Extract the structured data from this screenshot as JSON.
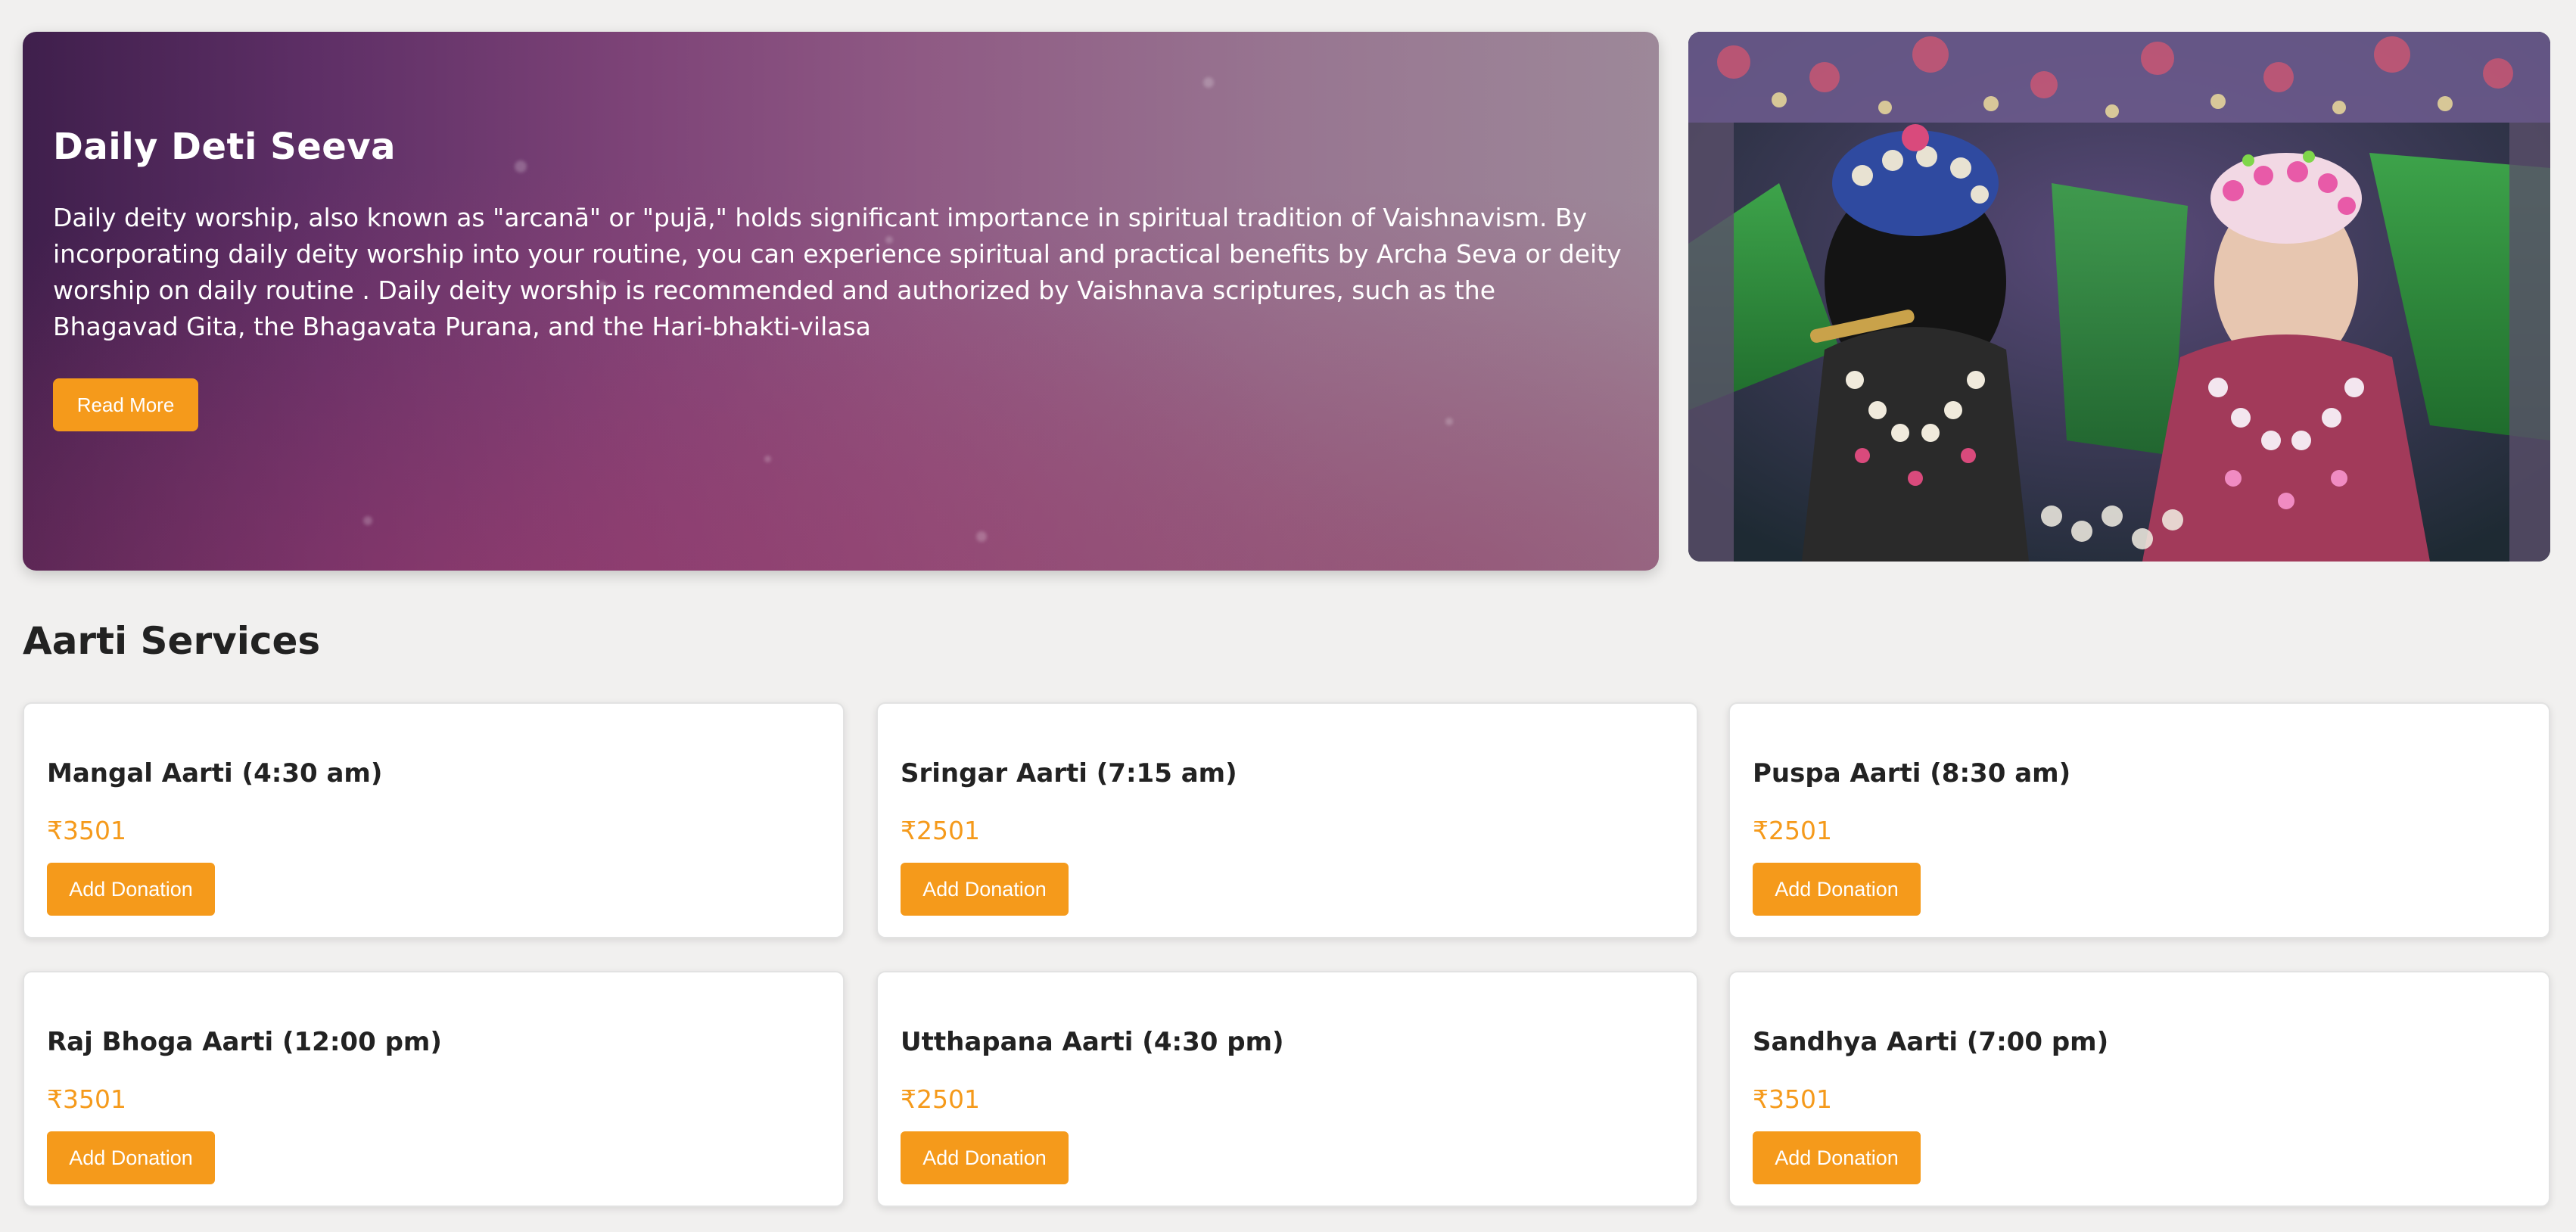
{
  "hero": {
    "title": "Daily Deti Seeva",
    "description": "Daily deity worship, also known as \"arcanā\" or \"pujā,\" holds significant importance in spiritual tradition of Vaishnavism. By incorporating daily deity worship into your routine, you can experience spiritual and practical benefits by Archa Seva or deity worship on daily routine . Daily deity worship is recommended and authorized by Vaishnava scriptures, such as the Bhagavad Gita, the Bhagavata Purana, and the Hari-bhakti-vilasa",
    "button_label": "Read More",
    "gradient_colors": [
      "#3f1f4c",
      "#7e4478",
      "#9d8899"
    ]
  },
  "deity_image": {
    "icon": "deity-photo"
  },
  "aarti_section": {
    "heading": "Aarti Services",
    "accent_color": "#f59a1b",
    "services": [
      {
        "name": "Mangal Aarti (4:30 am)",
        "price": "₹3501",
        "button_label": "Add Donation"
      },
      {
        "name": "Sringar Aarti (7:15 am)",
        "price": "₹2501",
        "button_label": "Add Donation"
      },
      {
        "name": "Puspa Aarti (8:30 am)",
        "price": "₹2501",
        "button_label": "Add Donation"
      },
      {
        "name": "Raj Bhoga Aarti (12:00 pm)",
        "price": "₹3501",
        "button_label": "Add Donation"
      },
      {
        "name": "Utthapana Aarti (4:30 pm)",
        "price": "₹2501",
        "button_label": "Add Donation"
      },
      {
        "name": "Sandhya Aarti (7:00 pm)",
        "price": "₹3501",
        "button_label": "Add Donation"
      }
    ]
  }
}
